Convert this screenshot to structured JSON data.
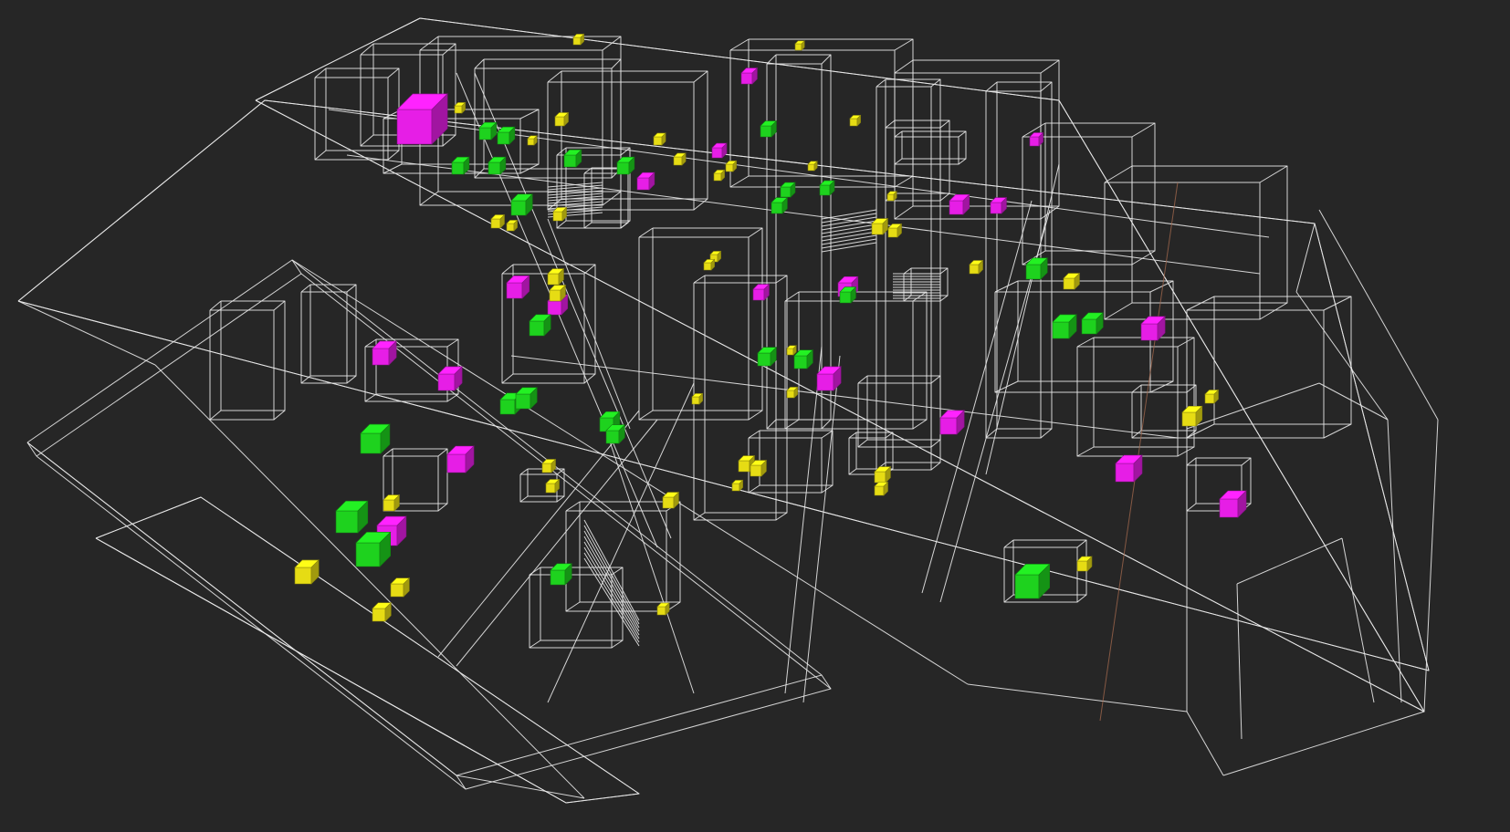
{
  "viewport": {
    "background": "#262626",
    "wireframe_color": "#e8e8e8",
    "axis_color": "#a66a4e"
  },
  "legend_colors": {
    "magenta": "#e61ee6",
    "green": "#1ed21e",
    "yellow": "#e6dc14"
  }
}
